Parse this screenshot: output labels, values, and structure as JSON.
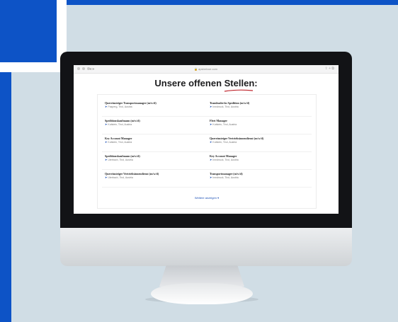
{
  "page": {
    "accent_blue": "#0d53c6",
    "background": "#d0dde5"
  },
  "browser": {
    "nav": "◂ ▸",
    "url": "🔒 apsbelvue.com",
    "toolbar_icons": "⇪ + ⧉"
  },
  "headline": {
    "prefix": "Unsere offenen",
    "highlight": "Stellen:"
  },
  "jobs": [
    {
      "title": "Quereinsteiger Transportmanager (m/w/d)",
      "location": "Pasperg, Tirol, Austria"
    },
    {
      "title": "Teamleader/in Spedition (m/w/d)",
      "location": "Innsbruck, Tirol, Austria"
    },
    {
      "title": "Speditionskaufmann (m/w/d)",
      "location": "Kufstein, Tirol, Austria"
    },
    {
      "title": "Fleet Manager",
      "location": "Kufstein, Tirol, Austria"
    },
    {
      "title": "Key Account Manager",
      "location": "Kufstein, Tirol, Austria"
    },
    {
      "title": "Quereinsteiger Vertriebsinnendienst (m/w/d)",
      "location": "Kufstein, Tirol, Austria"
    },
    {
      "title": "Speditionskaufmann (m/w/d)",
      "location": "Uterbach, Tirol, Austria"
    },
    {
      "title": "Key Account Manager",
      "location": "Innsbruck, Tirol, Austria"
    },
    {
      "title": "Quereinsteiger Vertriebsinnendienst (m/w/d)",
      "location": "Uterbach, Tirol, Austria"
    },
    {
      "title": "Transportmanager (m/w/d)",
      "location": "Innsbruck, Tirol, Austria"
    }
  ],
  "more_link": "Weitere anzeigen ▾"
}
